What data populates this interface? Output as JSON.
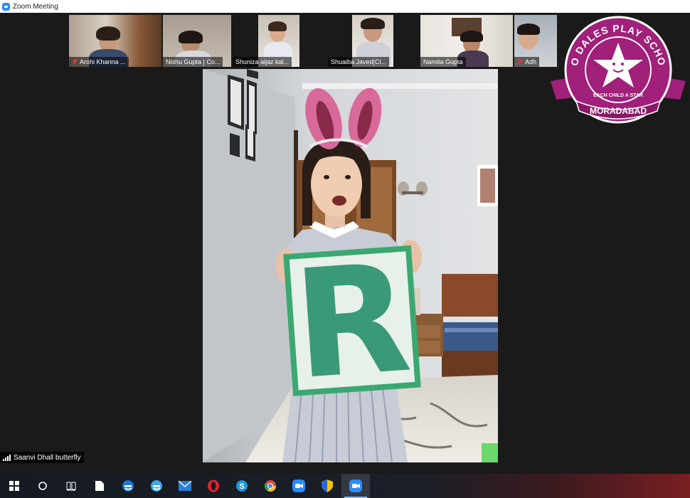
{
  "window": {
    "title": "Zoom Meeting"
  },
  "participants": [
    {
      "name": "Arohi Khanna ...",
      "muted": true
    },
    {
      "name": "Nishu Gupta | Co...",
      "muted": false
    },
    {
      "name": "Shuniza aijaz kal...",
      "muted": false
    },
    {
      "name": "Shuaiba Javed|Cl...",
      "muted": false
    },
    {
      "name": "Namita Gupta",
      "muted": false
    },
    {
      "name": "Adh",
      "muted": true
    }
  ],
  "active_speaker": {
    "name": "Saanvi Dhall butterfly",
    "card_letter": "R"
  },
  "school_badge": {
    "name": "NEO DALES PLAY SCHOOL",
    "tagline": "EACH CHILD A STAR",
    "city": "MORADABAD",
    "color": "#a0207a"
  },
  "taskbar": {
    "items": [
      "windows-start-icon",
      "search-icon",
      "task-view-icon",
      "file-icon",
      "edge-legacy-icon",
      "edge-icon",
      "mail-icon",
      "opera-icon",
      "skype-icon",
      "chrome-icon",
      "zoom-icon",
      "security-shield-icon",
      "zoom-meeting-icon"
    ]
  }
}
